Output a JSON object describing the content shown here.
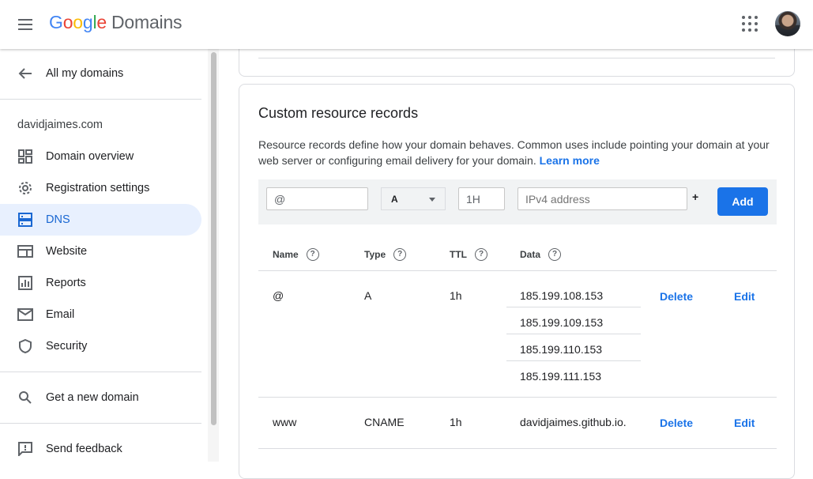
{
  "header": {
    "logo_google": [
      "G",
      "o",
      "o",
      "g",
      "l",
      "e"
    ],
    "logo_product": "Domains"
  },
  "sidebar": {
    "back_label": "All my domains",
    "domain": "davidjaimes.com",
    "items": [
      {
        "label": "Domain overview",
        "icon": "dashboard-icon"
      },
      {
        "label": "Registration settings",
        "icon": "gear-icon"
      },
      {
        "label": "DNS",
        "icon": "dns-icon",
        "active": true
      },
      {
        "label": "Website",
        "icon": "web-icon"
      },
      {
        "label": "Reports",
        "icon": "bar-chart-icon"
      },
      {
        "label": "Email",
        "icon": "mail-icon"
      },
      {
        "label": "Security",
        "icon": "shield-icon"
      }
    ],
    "get_domain_label": "Get a new domain",
    "feedback_label": "Send feedback"
  },
  "records": {
    "title": "Custom resource records",
    "description": "Resource records define how your domain behaves. Common uses include pointing your domain at your web server or configuring email delivery for your domain.",
    "learn_more": "Learn more",
    "form": {
      "name_value": "@",
      "type_value": "A",
      "ttl_value": "1H",
      "data_placeholder": "IPv4 address",
      "plus": "+",
      "add_label": "Add"
    },
    "columns": [
      "Name",
      "Type",
      "TTL",
      "Data"
    ],
    "help_glyph": "?",
    "rows": [
      {
        "name": "@",
        "type": "A",
        "ttl": "1h",
        "data": [
          "185.199.108.153",
          "185.199.109.153",
          "185.199.110.153",
          "185.199.111.153"
        ]
      },
      {
        "name": "www",
        "type": "CNAME",
        "ttl": "1h",
        "data": [
          "davidjaimes.github.io."
        ]
      }
    ],
    "delete_label": "Delete",
    "edit_label": "Edit"
  },
  "colors": {
    "accent": "#1a73e8",
    "active_bg": "#e8f0fe",
    "active_text": "#1967d2"
  }
}
